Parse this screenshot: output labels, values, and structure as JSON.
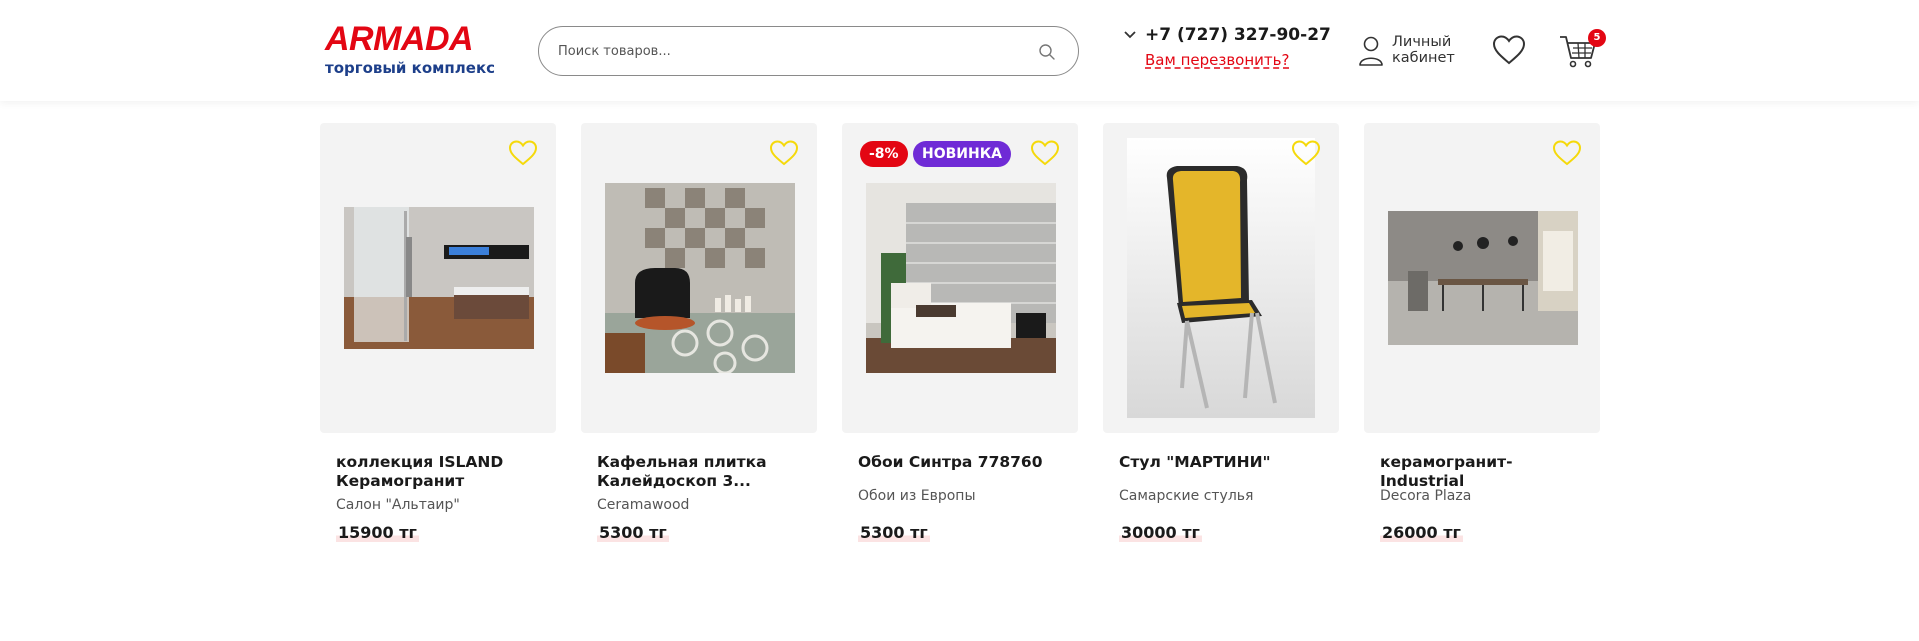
{
  "header": {
    "logo_text": "ARMADA",
    "logo_subtitle": "торговый комплекс",
    "search_placeholder": "Поиск товаров...",
    "phone": "+7 (727) 327-90-27",
    "callback_label": "Вам перезвонить?",
    "account_label": "Личный кабинет",
    "cart_count": "5",
    "brand_colors": {
      "red": "#e30613",
      "blue": "#1d3f8a",
      "new_badge": "#6f2bd6",
      "fav_icon": "#f5d90a"
    }
  },
  "products": [
    {
      "title": "коллекция ISLAND Керамогранит",
      "seller": "Салон \"Альтаир\"",
      "price": "15900 тг",
      "badges": []
    },
    {
      "title": "Кафельная плитка Калейдоскоп 3...",
      "seller": "Ceramawood",
      "price": "5300 тг",
      "badges": []
    },
    {
      "title": "Обои Синтра 778760",
      "seller": "Обои из Европы",
      "price": "5300 тг",
      "badges": [
        "-8%",
        "НОВИНКА"
      ]
    },
    {
      "title": "Стул \"МАРТИНИ\"",
      "seller": "Самарские стулья",
      "price": "30000 тг",
      "badges": []
    },
    {
      "title": "керамогранит-Industrial",
      "seller": "Decora Plaza",
      "price": "26000 тг",
      "badges": []
    }
  ]
}
